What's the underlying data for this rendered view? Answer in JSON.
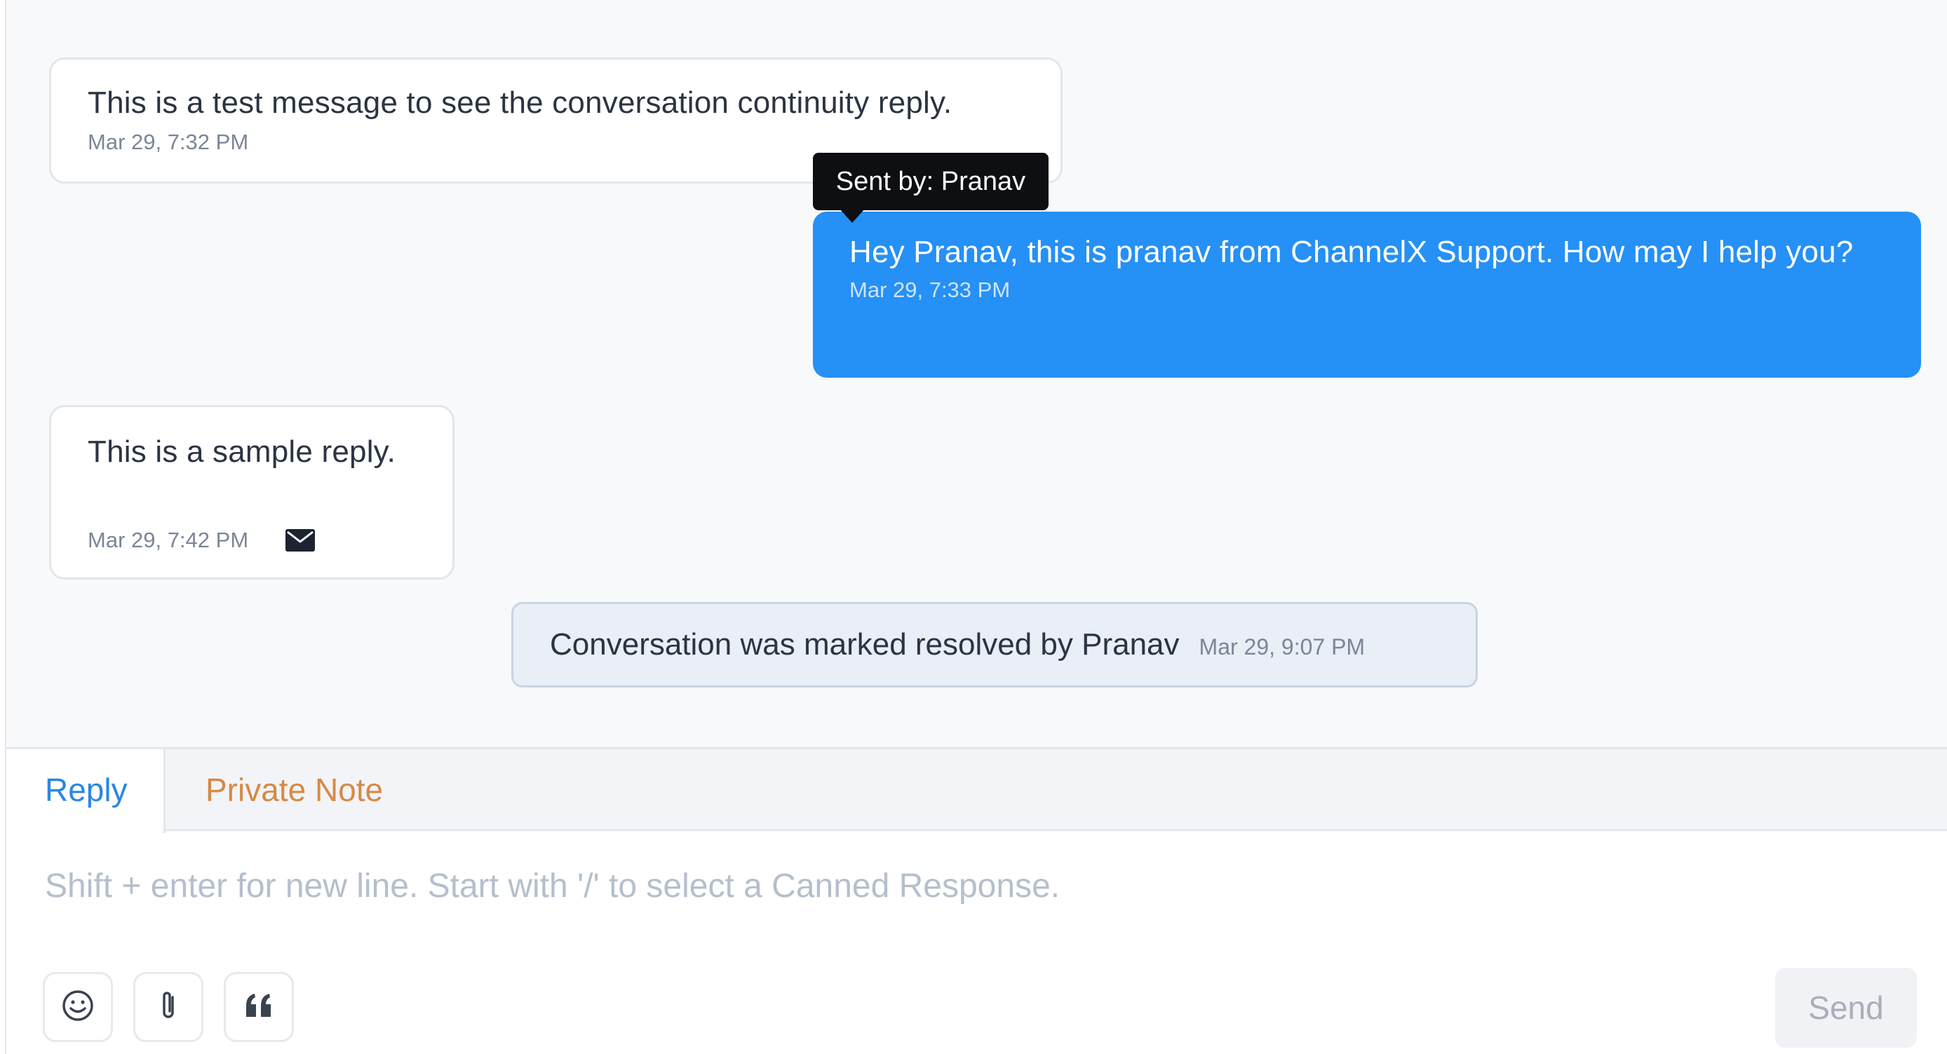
{
  "messages": [
    {
      "text": "This is a test message to see the conversation continuity reply.",
      "time": "Mar 29, 7:32 PM",
      "direction": "incoming"
    },
    {
      "text": "Hey Pranav, this is pranav from ChannelX Support. How may I help you?",
      "time": "Mar 29, 7:33 PM",
      "direction": "outgoing",
      "tooltip": "Sent by: Pranav"
    },
    {
      "text": "This is a sample reply.",
      "time": "Mar 29, 7:42 PM",
      "direction": "incoming",
      "icon": "mail-icon"
    }
  ],
  "activity": {
    "text": "Conversation was marked resolved by Pranav",
    "time": "Mar 29, 9:07 PM"
  },
  "reply_box": {
    "tabs": [
      {
        "label": "Reply",
        "active": true
      },
      {
        "label": "Private Note",
        "active": false
      }
    ],
    "placeholder": "Shift + enter for new line. Start with '/' to select a Canned Response.",
    "tools": [
      "emoji-icon",
      "attachment-icon",
      "quote-icon"
    ],
    "send_label": "Send"
  },
  "colors": {
    "outgoing_bubble": "#2590f6",
    "reply_tab": "#2a86e5",
    "private_note_tab": "#d58a47"
  }
}
